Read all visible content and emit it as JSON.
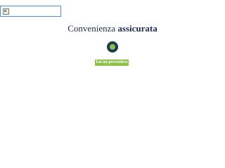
{
  "headline": {
    "part1": "Convenienza",
    "part2": "assicurata"
  },
  "cta": {
    "label": "Fai un preventivo"
  },
  "icons": {
    "broken_image": "broken-image-icon",
    "logo": "ring-logo-icon"
  },
  "colors": {
    "brand_dark": "#1e3a52",
    "brand_green": "#8cc14a",
    "text": "#1e2a4a"
  }
}
